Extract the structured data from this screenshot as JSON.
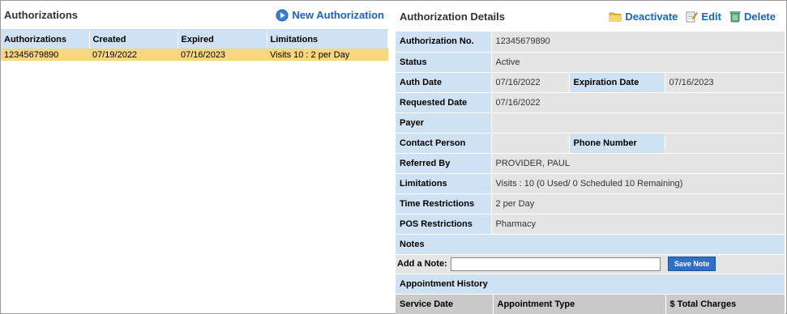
{
  "authorizations": {
    "title": "Authorizations",
    "new_button": "New Authorization",
    "columns": [
      "Authorizations",
      "Created",
      "Expired",
      "Limitations"
    ],
    "rows": [
      {
        "id": "12345679890",
        "created": "07/19/2022",
        "expired": "07/16/2023",
        "limitations": "Visits 10 : 2 per Day"
      }
    ]
  },
  "details": {
    "title": "Authorization Details",
    "deactivate": "Deactivate",
    "edit": "Edit",
    "delete": "Delete",
    "auth_no_label": "Authorization No.",
    "auth_no": "12345679890",
    "status_label": "Status",
    "status": "Active",
    "auth_date_label": "Auth Date",
    "auth_date": "07/16/2022",
    "expiration_label": "Expiration Date",
    "expiration": "07/16/2023",
    "requested_label": "Requested Date",
    "requested": "07/16/2022",
    "payer_label": "Payer",
    "payer": "",
    "contact_label": "Contact Person",
    "contact": "",
    "phone_label": "Phone Number",
    "phone": "",
    "referred_label": "Referred By",
    "referred": "PROVIDER, PAUL",
    "limitations_label": "Limitations",
    "limitations": "Visits : 10 (0 Used/ 0 Scheduled 10 Remaining)",
    "time_label": "Time Restrictions",
    "time": "2 per Day",
    "pos_label": "POS Restrictions",
    "pos": "Pharmacy",
    "notes_label": "Notes",
    "add_note_label": "Add a Note:",
    "note_value": "",
    "save_note": "Save Note",
    "history_label": "Appointment History",
    "history_columns": [
      "Service Date",
      "Appointment Type",
      "$ Total Charges"
    ]
  },
  "colors": {
    "header_blue": "#cfe2f3",
    "selected_row": "#fcd57f",
    "link_blue": "#1565c0",
    "value_gray": "#e4e4e4"
  }
}
